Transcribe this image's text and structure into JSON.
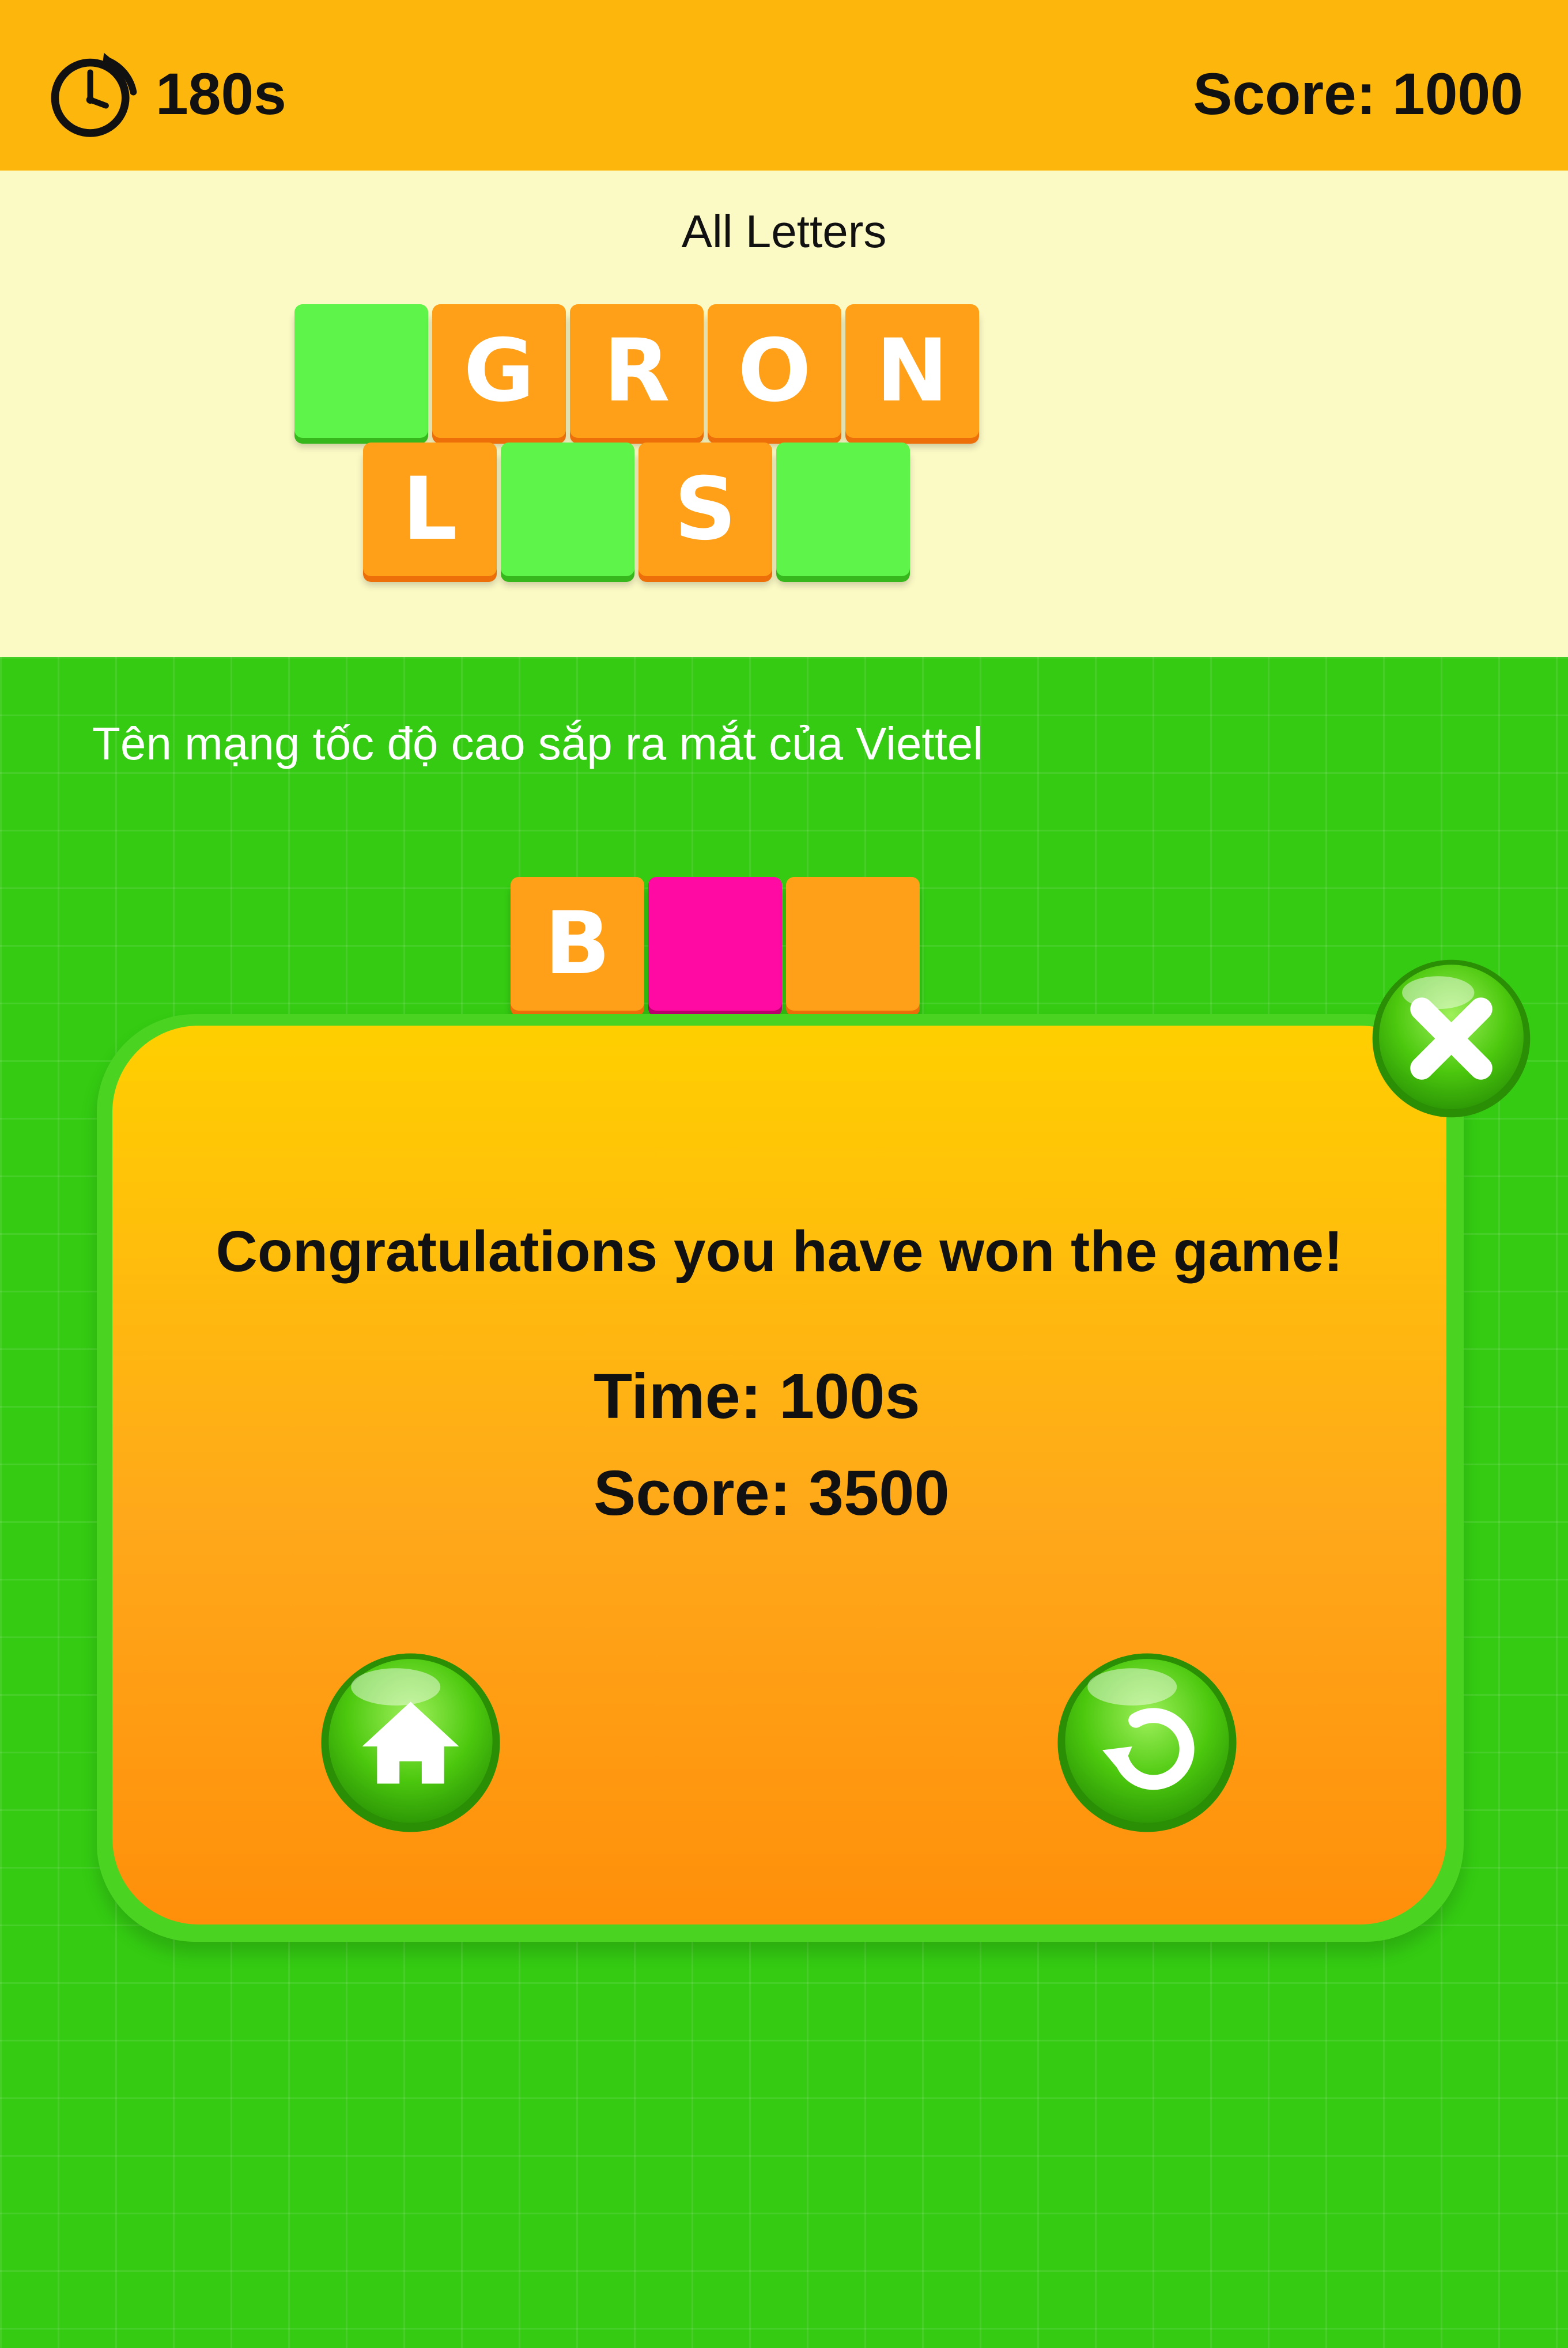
{
  "header": {
    "timer": "180s",
    "score": "Score: 1000"
  },
  "letters": {
    "title": "All Letters",
    "row1": [
      {
        "letter": "",
        "color": "green"
      },
      {
        "letter": "G",
        "color": "orange"
      },
      {
        "letter": "R",
        "color": "orange"
      },
      {
        "letter": "O",
        "color": "orange"
      },
      {
        "letter": "N",
        "color": "orange"
      }
    ],
    "row2": [
      {
        "letter": "L",
        "color": "orange"
      },
      {
        "letter": "",
        "color": "green"
      },
      {
        "letter": "S",
        "color": "orange"
      },
      {
        "letter": "",
        "color": "green"
      }
    ]
  },
  "question": "Tên mạng tốc độ cao sắp ra mắt của Viettel",
  "answer": [
    {
      "letter": "B",
      "color": "orange"
    },
    {
      "letter": "",
      "color": "pink"
    },
    {
      "letter": "",
      "color": "orange"
    }
  ],
  "popup": {
    "message": "Congratulations you have won the game!",
    "time": "Time: 100s",
    "score": "Score: 3500",
    "icons": {
      "close": "close-icon",
      "home": "home-icon",
      "replay": "replay-icon"
    }
  },
  "colors": {
    "top_bar": "#fdb60c",
    "letters_bg": "#fbf9c4",
    "game_bg": "#34cb12",
    "tile_orange": "#ffa018",
    "tile_green": "#5ef449",
    "tile_pink": "#ff0aa2",
    "popup_top": "#ffcf00",
    "popup_bottom": "#ff8f0a",
    "button_green": "#5fd810"
  }
}
